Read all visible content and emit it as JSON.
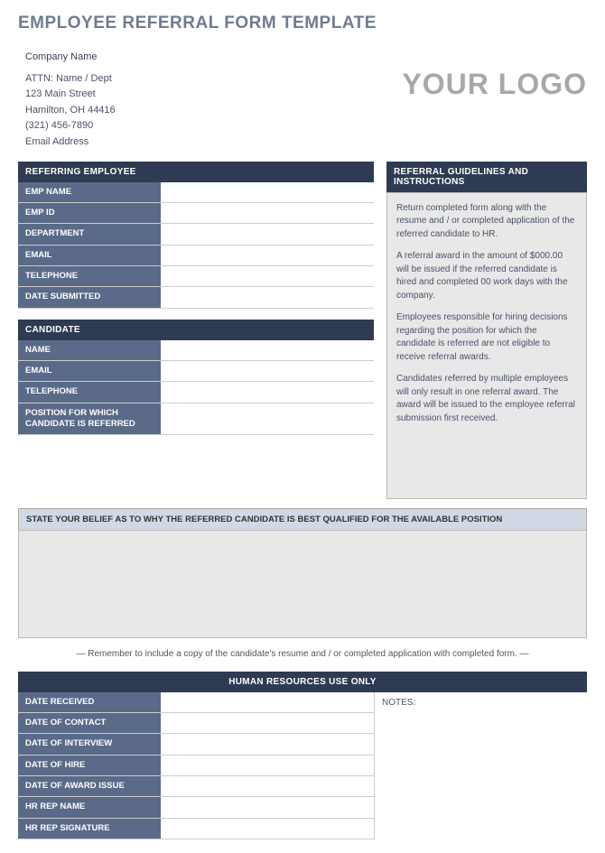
{
  "title": "EMPLOYEE REFERRAL FORM TEMPLATE",
  "company": {
    "name": "Company Name",
    "attn": "ATTN: Name / Dept",
    "street": "123 Main Street",
    "city_state_zip": "Hamilton, OH  44416",
    "phone": "(321) 456-7890",
    "email": "Email Address"
  },
  "logo_text": "YOUR LOGO",
  "referring_employee": {
    "header": "REFERRING EMPLOYEE",
    "fields": [
      {
        "label": "EMP NAME",
        "value": ""
      },
      {
        "label": "EMP ID",
        "value": ""
      },
      {
        "label": "DEPARTMENT",
        "value": ""
      },
      {
        "label": "EMAIL",
        "value": ""
      },
      {
        "label": "TELEPHONE",
        "value": ""
      },
      {
        "label": "DATE SUBMITTED",
        "value": ""
      }
    ]
  },
  "candidate": {
    "header": "CANDIDATE",
    "fields": [
      {
        "label": "NAME",
        "value": ""
      },
      {
        "label": "EMAIL",
        "value": ""
      },
      {
        "label": "TELEPHONE",
        "value": ""
      },
      {
        "label": "POSITION FOR WHICH CANDIDATE IS REFERRED",
        "value": ""
      }
    ]
  },
  "guidelines": {
    "header": "REFERRAL GUIDELINES AND INSTRUCTIONS",
    "paragraphs": [
      "Return completed form along with the resume and / or completed application of the referred candidate to HR.",
      "A referral award in the amount of $000.00 will be issued if the referred candidate is hired and completed 00 work days with the company.",
      "Employees responsible for hiring decisions regarding the position for which the candidate is referred are not eligible to receive referral awards.",
      "Candidates referred by multiple employees will only result in one referral award.  The award will be issued to the employee referral submission first received."
    ]
  },
  "belief": {
    "header": "STATE YOUR BELIEF AS TO WHY THE REFERRED CANDIDATE IS BEST QUALIFIED FOR THE AVAILABLE POSITION",
    "value": ""
  },
  "reminder": "— Remember to include a copy of the candidate's resume and / or completed application with completed form. —",
  "hr": {
    "header": "HUMAN RESOURCES USE ONLY",
    "notes_label": "NOTES:",
    "fields": [
      {
        "label": "DATE RECEIVED",
        "value": ""
      },
      {
        "label": "DATE OF CONTACT",
        "value": ""
      },
      {
        "label": "DATE OF INTERVIEW",
        "value": ""
      },
      {
        "label": "DATE OF HIRE",
        "value": ""
      },
      {
        "label": "DATE OF AWARD ISSUE",
        "value": ""
      },
      {
        "label": "HR REP NAME",
        "value": ""
      },
      {
        "label": "HR REP SIGNATURE",
        "value": ""
      }
    ]
  }
}
